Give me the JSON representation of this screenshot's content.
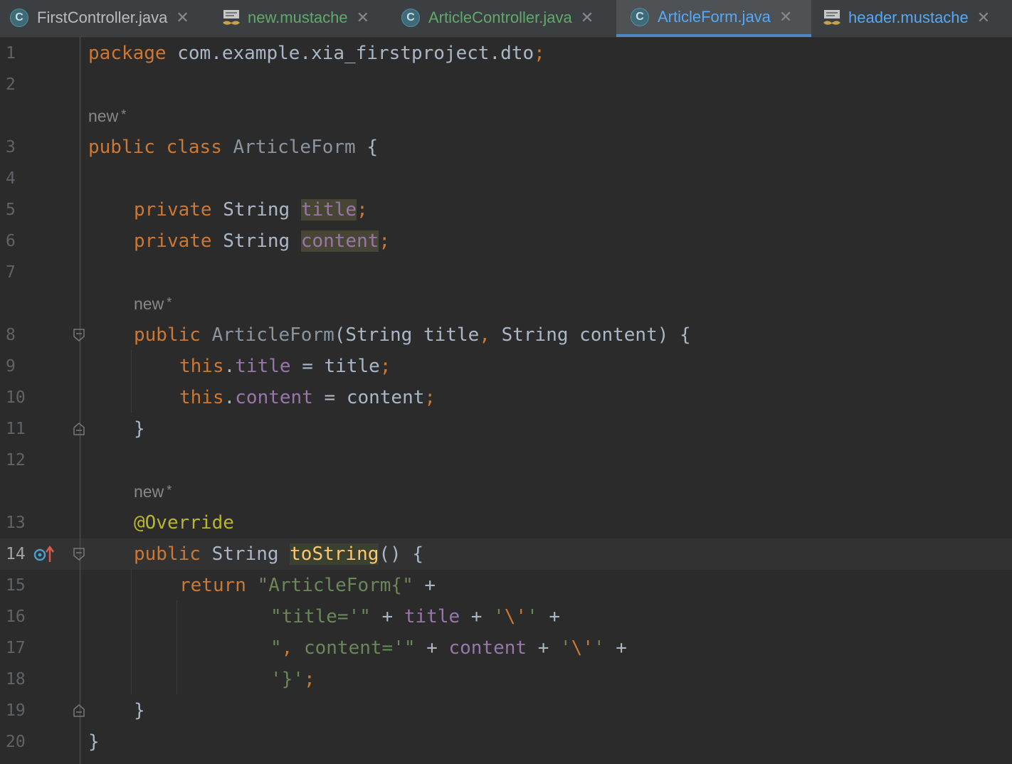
{
  "tabs": [
    {
      "label": "FirstController.java",
      "icon": "java-class-icon",
      "active": false
    },
    {
      "label": "new.mustache",
      "icon": "mustache-file-icon",
      "active": false
    },
    {
      "label": "ArticleController.java",
      "icon": "java-class-icon",
      "active": false
    },
    {
      "label": "ArticleForm.java",
      "icon": "java-class-icon",
      "active": true
    },
    {
      "label": "header.mustache",
      "icon": "mustache-file-icon",
      "active": false
    }
  ],
  "class_icon_letter": "C",
  "close_glyph": "✕",
  "hint_text": "new",
  "hint_star": "*",
  "line_numbers": [
    "1",
    "2",
    "3",
    "4",
    "5",
    "6",
    "7",
    "8",
    "9",
    "10",
    "11",
    "12",
    "13",
    "14",
    "15",
    "16",
    "17",
    "18",
    "19",
    "20"
  ],
  "current_line": "14",
  "code": {
    "l1_kw": "package",
    "l1_pkg": "com.example.xia_firstproject.dto",
    "l3_public": "public",
    "l3_class": "class",
    "l3_name": "ArticleForm",
    "l3_brace": "{",
    "private": "private",
    "string": "String",
    "title": "title",
    "content": "content",
    "semi": ";",
    "l8_public": "public",
    "l8_ctor": "ArticleForm",
    "l8_params_a": "(String title",
    "l8_comma": ",",
    "l8_params_b": " String content) {",
    "this": "this",
    "dot": ".",
    "assign_title": " = title",
    "assign_content": " = content",
    "close_brace": "}",
    "annotation": "@Override",
    "l14_public": "public",
    "l14_string": "String",
    "l14_method": "toString",
    "l14_rest": "() {",
    "return": "return",
    "s15": "\"ArticleForm{\"",
    "plus": " +",
    "s16a": "\"title='\"",
    "plus_mid": " + ",
    "q_open": "'",
    "esc_q": "\\'",
    "q_close": "'",
    "s17a": "\"",
    "s17_comma": ",",
    "s17b": " content='\"",
    "s18": "'}'"
  }
}
